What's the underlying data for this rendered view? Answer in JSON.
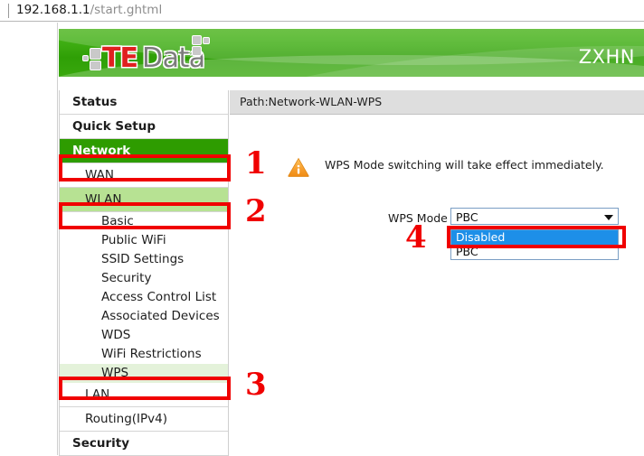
{
  "browser": {
    "url_host": "192.168.1.1",
    "url_path": "/start.ghtml"
  },
  "header": {
    "logo_te": "TE",
    "logo_data": "Data",
    "model": "ZXHN"
  },
  "sidebar": {
    "items": [
      {
        "label": "Status",
        "level": 1,
        "state": "none"
      },
      {
        "label": "Quick Setup",
        "level": 1,
        "state": "none"
      },
      {
        "label": "Network",
        "level": 1,
        "state": "dark"
      },
      {
        "label": "WAN",
        "level": 2,
        "state": "none"
      },
      {
        "label": "WLAN",
        "level": 2,
        "state": "mid"
      },
      {
        "label": "Basic",
        "level": 3,
        "state": "none"
      },
      {
        "label": "Public WiFi",
        "level": 3,
        "state": "none"
      },
      {
        "label": "SSID Settings",
        "level": 3,
        "state": "none"
      },
      {
        "label": "Security",
        "level": 3,
        "state": "none"
      },
      {
        "label": "Access Control List",
        "level": 3,
        "state": "none"
      },
      {
        "label": "Associated Devices",
        "level": 3,
        "state": "none"
      },
      {
        "label": "WDS",
        "level": 3,
        "state": "none"
      },
      {
        "label": "WiFi Restrictions",
        "level": 3,
        "state": "none"
      },
      {
        "label": "WPS",
        "level": 3,
        "state": "light"
      },
      {
        "label": "LAN",
        "level": 2,
        "state": "none"
      },
      {
        "label": "Routing(IPv4)",
        "level": 2,
        "state": "none"
      },
      {
        "label": "Security",
        "level": 1,
        "state": "none"
      }
    ]
  },
  "content": {
    "path": "Path:Network-WLAN-WPS",
    "notice": "WPS Mode switching will take effect immediately.",
    "notice_icon": "warning-triangle-icon",
    "form": {
      "wps_mode_label": "WPS Mode",
      "wps_mode_value": "PBC",
      "wps_mode_options": [
        "Disabled",
        "PBC"
      ],
      "wps_mode_highlighted": "Disabled"
    }
  },
  "annotations": {
    "numbers": [
      "1",
      "2",
      "3",
      "4"
    ],
    "color": "#f00000"
  }
}
